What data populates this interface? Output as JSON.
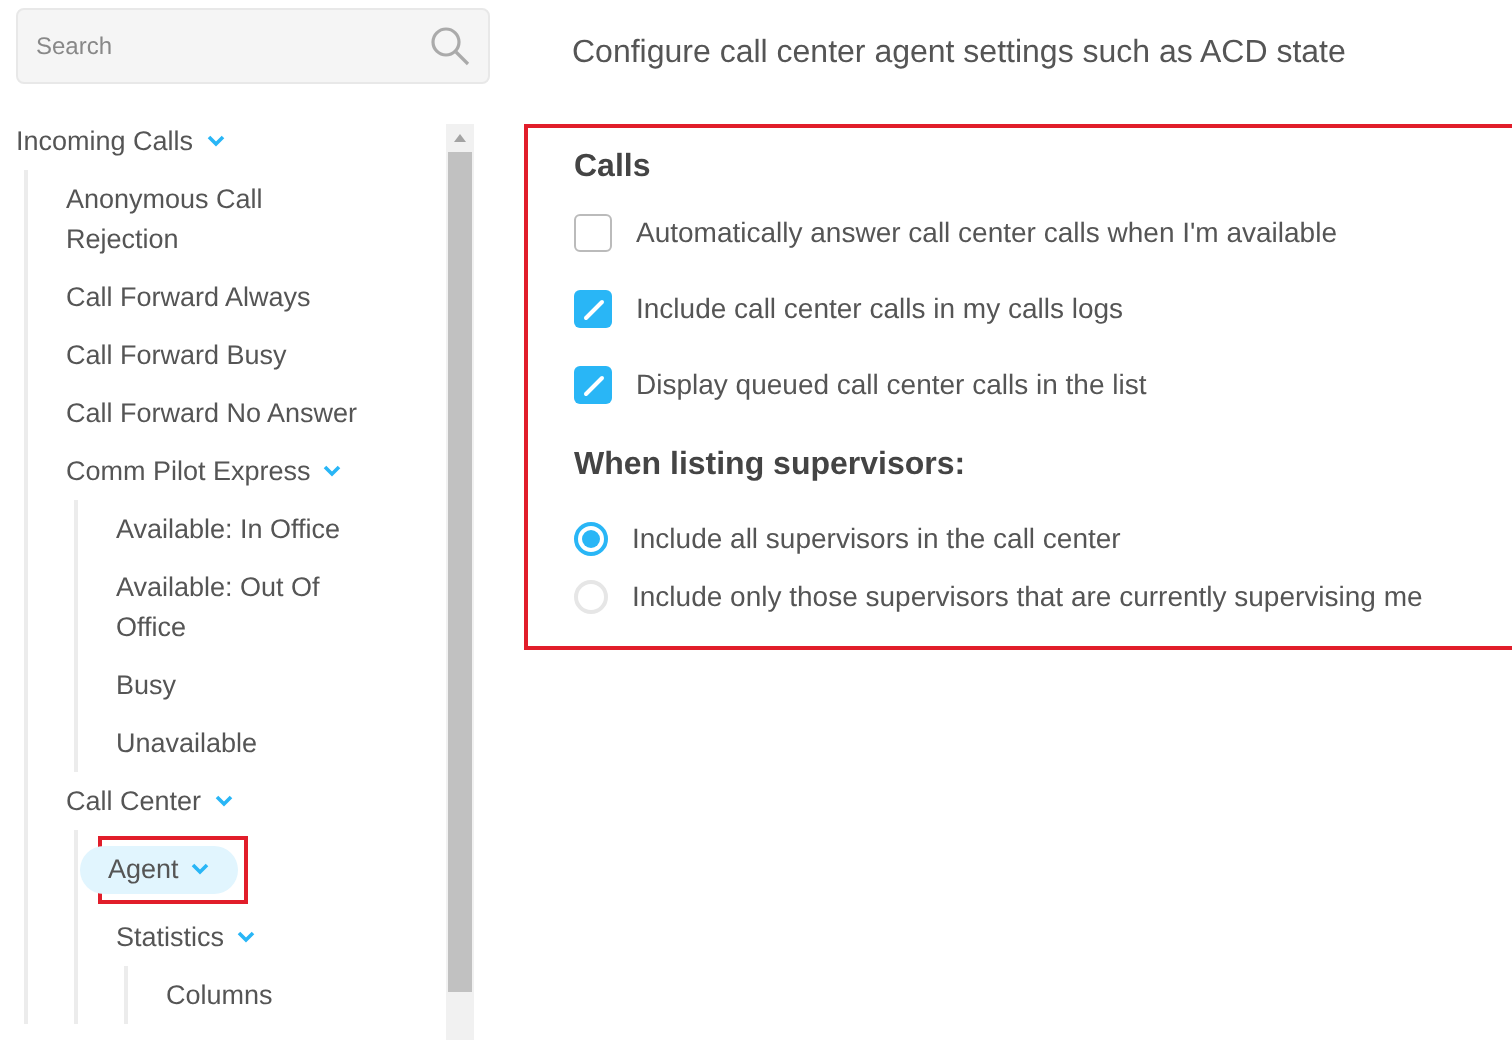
{
  "search": {
    "placeholder": "Search"
  },
  "tree": [
    {
      "label": "Incoming Calls",
      "expanded": true,
      "selected": false,
      "children": [
        {
          "label": "Anonymous Call Rejection",
          "selected": false
        },
        {
          "label": "Call Forward Always",
          "selected": false
        },
        {
          "label": "Call Forward Busy",
          "selected": false
        },
        {
          "label": "Call Forward No Answer",
          "selected": false
        },
        {
          "label": "Comm Pilot Express",
          "expanded": true,
          "selected": false,
          "children": [
            {
              "label": "Available: In Office",
              "selected": false
            },
            {
              "label": "Available: Out Of Office",
              "selected": false
            },
            {
              "label": "Busy",
              "selected": false
            },
            {
              "label": "Unavailable",
              "selected": false
            }
          ]
        },
        {
          "label": "Call Center",
          "expanded": true,
          "selected": false,
          "children": [
            {
              "label": "Agent",
              "expanded": true,
              "selected": true,
              "highlighted": true
            },
            {
              "label": "Statistics",
              "expanded": true,
              "selected": false,
              "children": [
                {
                  "label": "Columns",
                  "selected": false
                }
              ]
            }
          ]
        }
      ]
    }
  ],
  "description": "Configure call center agent settings such as ACD state",
  "panel": {
    "highlighted": true,
    "title": "Calls",
    "options": [
      {
        "label": "Automatically answer call center calls when I'm available",
        "checked": false
      },
      {
        "label": "Include call center calls in my calls logs",
        "checked": true
      },
      {
        "label": "Display queued call center calls in the list",
        "checked": true
      }
    ],
    "subtitle": "When listing supervisors:",
    "choices": [
      {
        "label": "Include all supervisors in the call center",
        "selected": true
      },
      {
        "label": "Include only those supervisors that are currently supervising me",
        "selected": false
      }
    ]
  }
}
